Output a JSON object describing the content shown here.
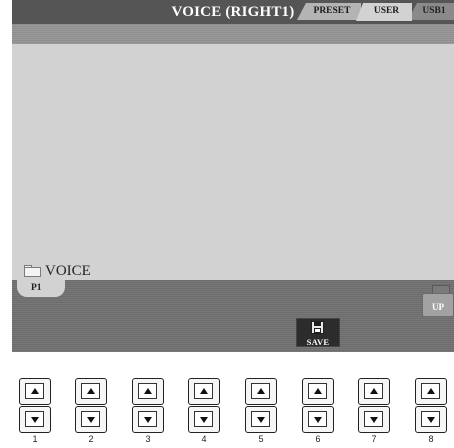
{
  "title": "VOICE (RIGHT1)",
  "tabs": [
    {
      "label": "PRESET",
      "state": "inactive"
    },
    {
      "label": "USER",
      "state": "selected"
    },
    {
      "label": "USB1",
      "state": "inactive"
    }
  ],
  "folder": {
    "icon": "folder-icon",
    "name": "VOICE"
  },
  "page_tab": "P1",
  "up_button": {
    "icon": "folder-up-icon",
    "label": "UP"
  },
  "save_button": {
    "icon": "floppy-disk-icon",
    "label": "SAVE"
  },
  "hardware_buttons": [
    {
      "number": "1"
    },
    {
      "number": "2"
    },
    {
      "number": "3"
    },
    {
      "number": "4"
    },
    {
      "number": "5"
    },
    {
      "number": "6"
    },
    {
      "number": "7"
    },
    {
      "number": "8"
    }
  ],
  "colors": {
    "title_bar": "#555555",
    "screen_bg": "#d2d2d2",
    "page_strip": "#737373",
    "save_button": "#2c2c2c"
  }
}
